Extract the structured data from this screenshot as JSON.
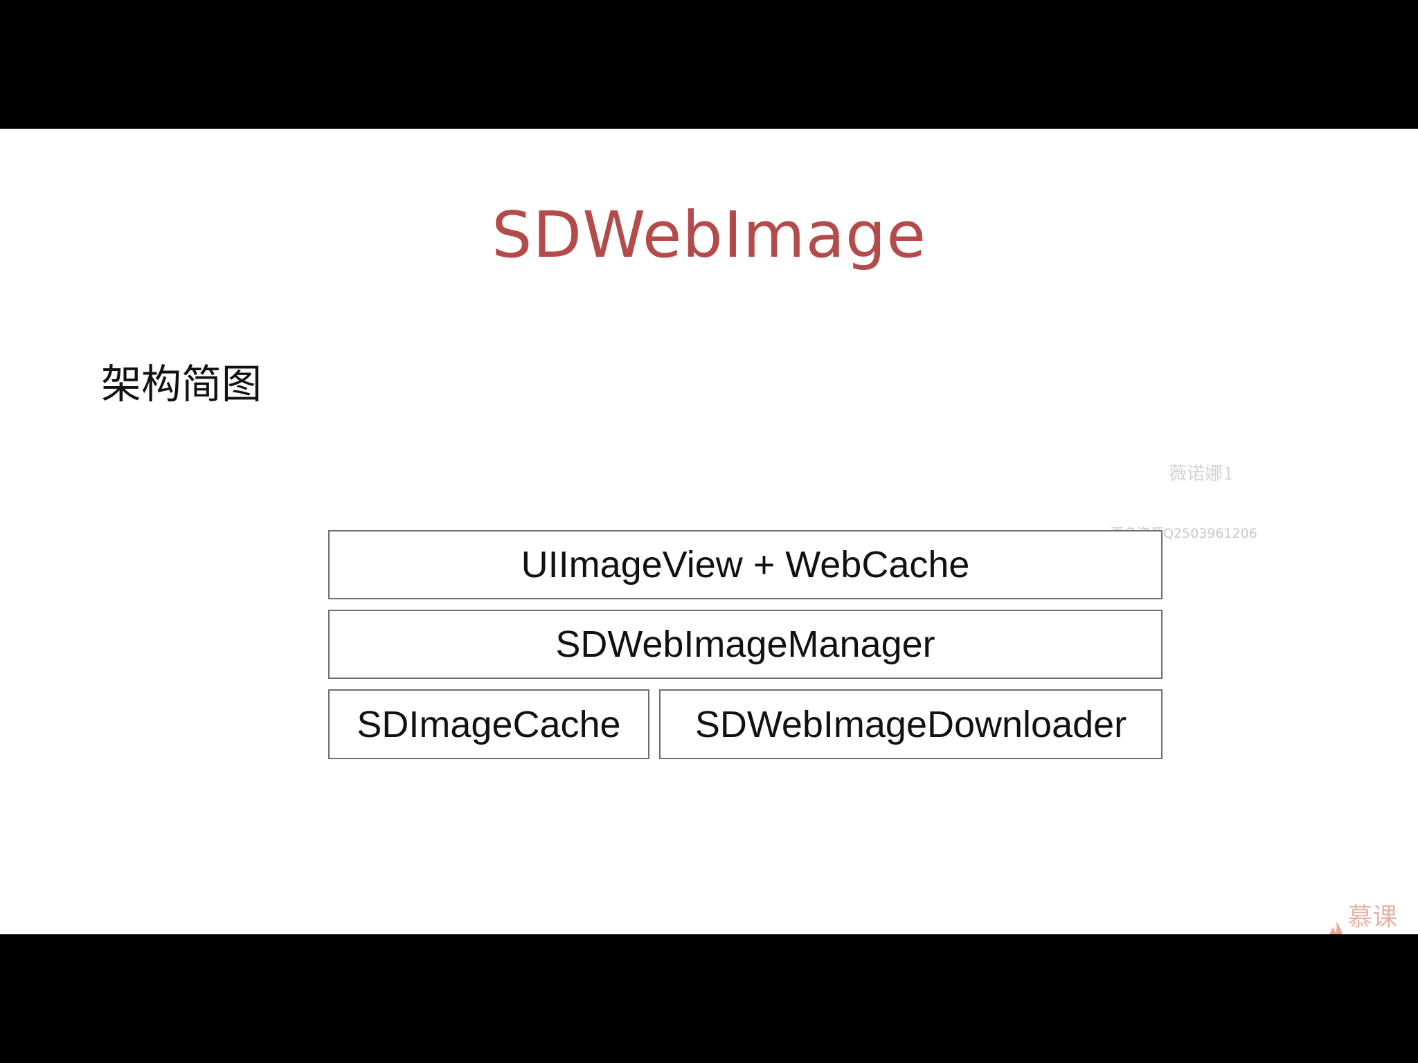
{
  "slide": {
    "title": "SDWebImage",
    "section_heading": "架构简图",
    "watermark": {
      "name": "薇诺娜1",
      "contact": "更多资源Q2503961206"
    },
    "logo_text": "慕课网",
    "title_color": "#b34b4b"
  },
  "architecture_diagram": {
    "layers": [
      {
        "label": "UIImageView + WebCache"
      },
      {
        "label": "SDWebImageManager"
      },
      {
        "label": "SDImageCache"
      },
      {
        "label": "SDWebImageDownloader"
      }
    ]
  }
}
